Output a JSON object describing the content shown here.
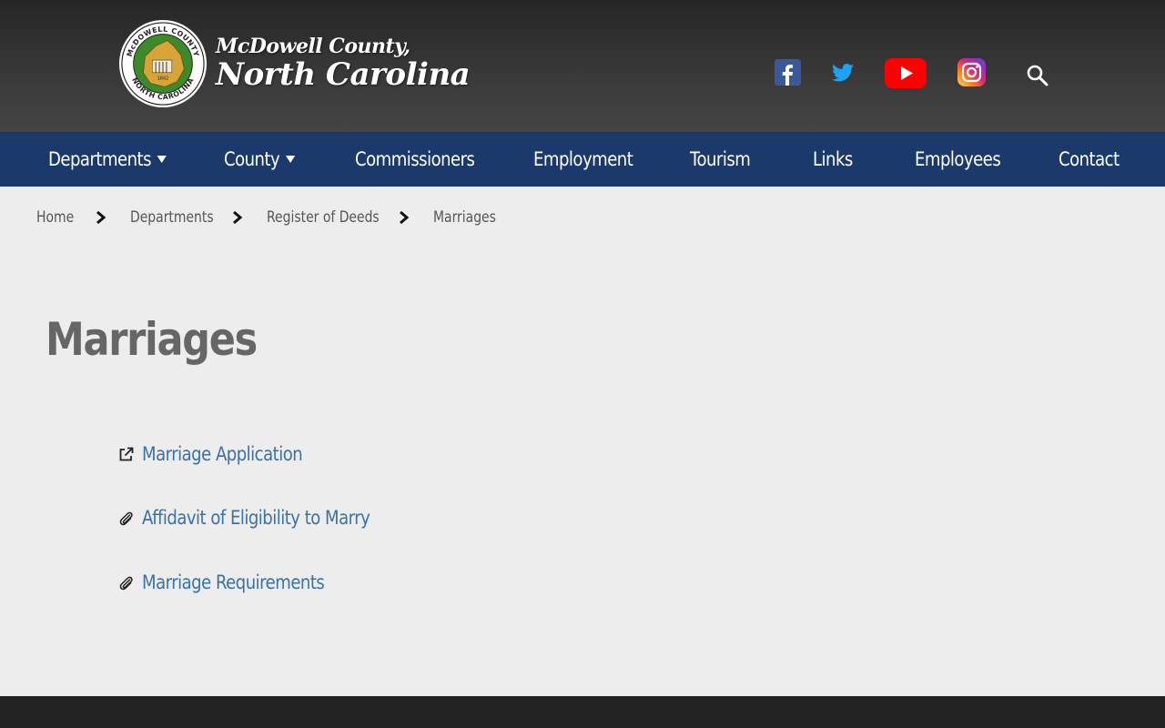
{
  "header": {
    "logo_seal": {
      "ring_text_top": "McDOWELL COUNTY",
      "ring_text_bottom": "NORTH CAROLINA",
      "year": "1842"
    },
    "brand_line1": "McDowell County,",
    "brand_line2": "North Carolina",
    "social_icons": [
      "facebook-icon",
      "twitter-icon",
      "youtube-icon",
      "instagram-icon",
      "search-icon"
    ]
  },
  "nav": {
    "items": [
      {
        "label": "Departments",
        "dropdown": true
      },
      {
        "label": "County",
        "dropdown": true
      },
      {
        "label": "Commissioners",
        "dropdown": false
      },
      {
        "label": "Employment",
        "dropdown": false
      },
      {
        "label": "Tourism",
        "dropdown": false
      },
      {
        "label": "Links",
        "dropdown": false
      },
      {
        "label": "Employees",
        "dropdown": false
      },
      {
        "label": "Contact",
        "dropdown": false
      }
    ]
  },
  "breadcrumb": [
    "Home",
    "Departments",
    "Register of Deeds",
    "Marriages"
  ],
  "page": {
    "title": "Marriages",
    "links": [
      {
        "label": "Marriage Application",
        "icon": "external-link-icon"
      },
      {
        "label": "Affidavit of Eligibility to Marry",
        "icon": "paperclip-icon"
      },
      {
        "label": "Marriage Requirements",
        "icon": "paperclip-icon"
      }
    ]
  },
  "colors": {
    "nav_bg": "#1b3a6b",
    "link": "#3a72a8",
    "page_bg": "#ededed",
    "header_bg": "#333333"
  }
}
